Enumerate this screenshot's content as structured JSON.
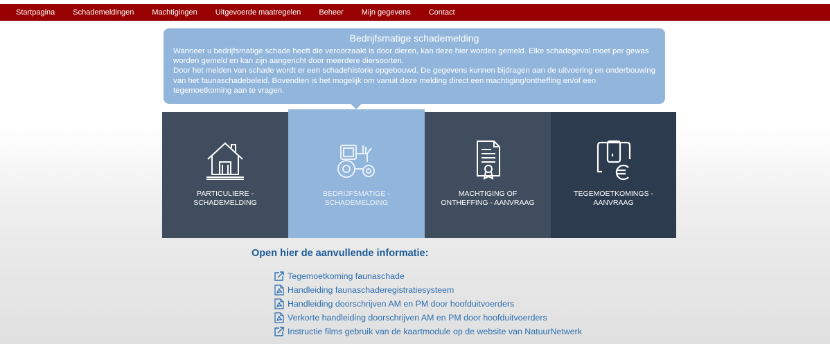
{
  "nav": {
    "items": [
      {
        "label": "Startpagina"
      },
      {
        "label": "Schademeldingen"
      },
      {
        "label": "Machtigingen"
      },
      {
        "label": "Uitgevoerde maatregelen"
      },
      {
        "label": "Beheer"
      },
      {
        "label": "Mijn gegevens"
      },
      {
        "label": "Contact"
      }
    ]
  },
  "info_bubble": {
    "title": "Bedrijfsmatige schademelding",
    "paragraph_1": "Wanneer u bedrijfsmatige schade heeft die veroorzaakt is door dieren, kan deze hier worden gemeld. Elke schadegeval moet per gewas worden gemeld en kan zijn aangericht door meerdere diersoorten.",
    "paragraph_2": "Door het melden van schade wordt er een schadehistorie opgebouwd. De gegevens kunnen bijdragen aan de uitvoering en onderbouwing van het faunaschadebeleid. Bovendien is het mogelijk om vanuit deze melding direct een machtiging/ontheffing en/of een tegemoetkoming aan te vragen."
  },
  "tiles": [
    {
      "line1": "Particuliere -",
      "line2": "schademelding",
      "icon": "house-icon",
      "selected": false
    },
    {
      "line1": "Bedrijfsmatige -",
      "line2": "schademelding",
      "icon": "tractor-icon",
      "selected": true
    },
    {
      "line1": "Machtiging of",
      "line2": "ontheffing - aanvraag",
      "icon": "certificate-icon",
      "selected": false
    },
    {
      "line1": "Tegemoetkomings -",
      "line2": "aanvraag",
      "icon": "euro-device-icon",
      "selected": false
    }
  ],
  "info_section": {
    "heading": "Open hier de aanvullende informatie:",
    "links": [
      {
        "label": "Tegemoetkoming faunaschade",
        "icon": "external-link-icon"
      },
      {
        "label": "Handleiding faunaschaderegistratiesysteem",
        "icon": "pdf-icon"
      },
      {
        "label": "Handleiding doorschrijven AM en PM door hoofduitvoerders",
        "icon": "pdf-icon"
      },
      {
        "label": "Verkorte handleiding doorschrijven AM en PM door hoofduitvoerders",
        "icon": "pdf-icon"
      },
      {
        "label": "Instructie films gebruik van de kaartmodule op de website van NatuurNetwerk",
        "icon": "external-link-icon"
      }
    ]
  },
  "colors": {
    "nav_bg": "#990000",
    "bubble_bg": "#92b5db",
    "tile_dark": "#3f4d5e",
    "tile_darker": "#2c3b4d",
    "link": "#2d6fb0",
    "heading": "#1c5a96"
  }
}
